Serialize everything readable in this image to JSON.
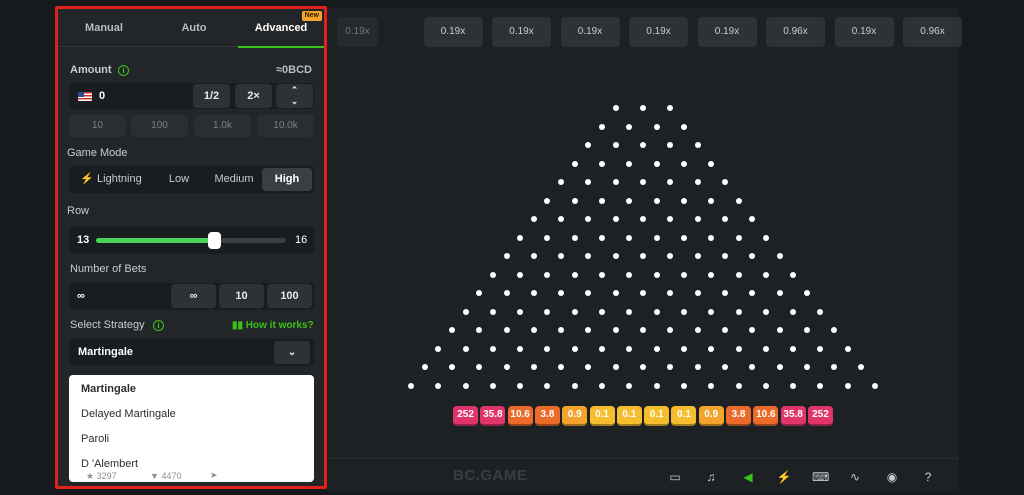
{
  "tabs": {
    "manual": "Manual",
    "auto": "Auto",
    "advanced": "Advanced",
    "new_badge": "New"
  },
  "amount": {
    "label": "Amount",
    "currency_value": "≈0BCD",
    "value": "0",
    "half": "1/2",
    "double": "2×",
    "stepper": "⌃⌄",
    "presets": [
      "10",
      "100",
      "1.0k",
      "10.0k"
    ]
  },
  "game_mode": {
    "label": "Game Mode",
    "options": [
      "Lightning",
      "Low",
      "Medium",
      "High"
    ],
    "selected": "High",
    "lightning_icon": "⚡"
  },
  "row": {
    "label": "Row",
    "min": "13",
    "max": "16",
    "value_fraction": 0.62
  },
  "bets": {
    "label": "Number of Bets",
    "value": "∞",
    "options": [
      "∞",
      "10",
      "100"
    ]
  },
  "strategy": {
    "label": "Select Strategy",
    "help": "How it works?",
    "selected": "Martingale",
    "options": [
      "Martingale",
      "Delayed Martingale",
      "Paroli",
      "D 'Alembert"
    ]
  },
  "stats": {
    "likes": "3297",
    "favorites": "4470"
  },
  "history": [
    "0.19x",
    "0.19x",
    "0.19x",
    "0.19x",
    "0.19x",
    "0.19x",
    "0.96x",
    "0.19x",
    "0.96x"
  ],
  "multipliers": [
    "252",
    "35.8",
    "10.6",
    "3.8",
    "0.9",
    "0.1",
    "0.1",
    "0.1",
    "0.1",
    "0.9",
    "3.8",
    "10.6",
    "35.8",
    "252"
  ],
  "multiplier_colors": {
    "high": "#e0356a",
    "mid": "#ec6a2a",
    "low": "#f2a42c",
    "min": "#f6be2e"
  },
  "footer": {
    "logo": "BC.GAME",
    "icons": [
      "window-icon",
      "music-icon",
      "sound-icon",
      "lightning-icon",
      "keyboard-icon",
      "stats-icon",
      "security-icon",
      "help-icon"
    ]
  }
}
